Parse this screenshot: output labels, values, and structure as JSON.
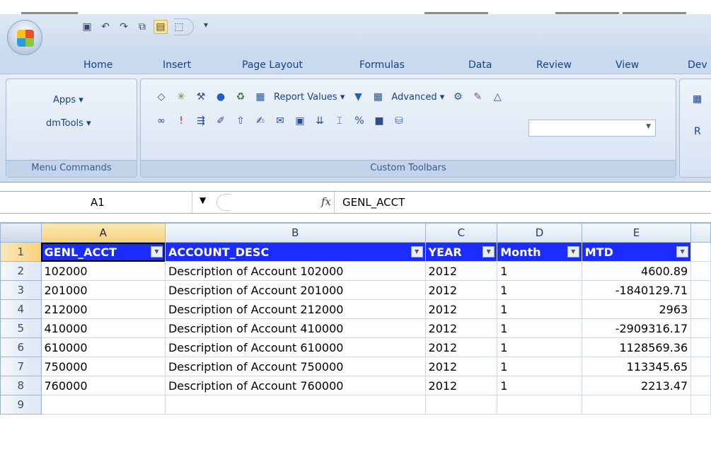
{
  "quick_access": {
    "icons": [
      "save-icon",
      "undo-icon",
      "redo-icon",
      "copy-icon",
      "table-icon",
      "shape-icon",
      "customize-icon"
    ]
  },
  "tabs": [
    {
      "label": "Home"
    },
    {
      "label": "Insert"
    },
    {
      "label": "Page Layout"
    },
    {
      "label": "Formulas"
    },
    {
      "label": "Data"
    },
    {
      "label": "Review"
    },
    {
      "label": "View"
    },
    {
      "label": "Dev"
    }
  ],
  "ribbon": {
    "menu_group": {
      "apps": "Apps ▾",
      "dmtools": "dmTools ▾",
      "caption": "Menu Commands"
    },
    "toolbars_group": {
      "report_values": "Report Values ▾",
      "advanced": "Advanced ▾",
      "caption": "Custom Toolbars"
    },
    "partial_group": {
      "label": "R"
    }
  },
  "formula_bar": {
    "name_box": "A1",
    "fx": "fx",
    "formula": "GENL_ACCT"
  },
  "sheet": {
    "columns": [
      "A",
      "B",
      "C",
      "D",
      "E"
    ],
    "headers": [
      "GENL_ACCT",
      "ACCOUNT_DESC",
      "YEAR",
      "Month",
      "MTD"
    ],
    "row_numbers": [
      "1",
      "2",
      "3",
      "4",
      "5",
      "6",
      "7",
      "8",
      "9"
    ],
    "rows": [
      [
        "102000",
        "Description of Account 102000",
        "2012",
        "1",
        "4600.89"
      ],
      [
        "201000",
        "Description of Account 201000",
        "2012",
        "1",
        "-1840129.71"
      ],
      [
        "212000",
        "Description of Account 212000",
        "2012",
        "1",
        "2963"
      ],
      [
        "410000",
        "Description of Account 410000",
        "2012",
        "1",
        "-2909316.17"
      ],
      [
        "610000",
        "Description of Account 610000",
        "2012",
        "1",
        "1128569.36"
      ],
      [
        "750000",
        "Description of Account 750000",
        "2012",
        "1",
        "113345.65"
      ],
      [
        "760000",
        "Description of Account 760000",
        "2012",
        "1",
        "2213.47"
      ]
    ]
  }
}
